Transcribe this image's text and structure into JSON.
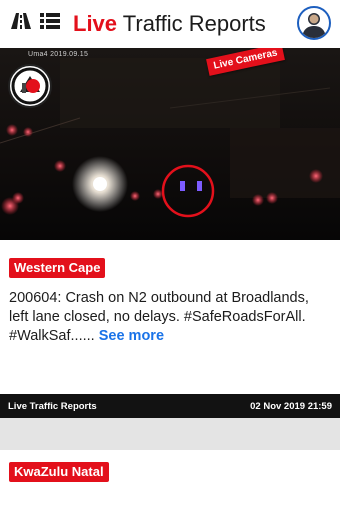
{
  "header": {
    "title_live": "Live",
    "title_rest": " Traffic Reports",
    "icons": [
      "road-icon",
      "list-icon",
      "user-avatar-icon"
    ]
  },
  "reports": [
    {
      "camera_stamp": "Uma4 2019.09.15",
      "camera_badge": "Live Cameras",
      "region": "Western Cape",
      "text": "200604: Crash on N2 outbound at Broadlands, left lane closed, no delays. #SafeRoadsForAll. #WalkSaf...... ",
      "see_more": "See more",
      "source": "Live Traffic Reports",
      "timestamp": "02 Nov 2019 21:59"
    },
    {
      "region": "KwaZulu Natal"
    }
  ],
  "colors": {
    "accent_red": "#e3101b",
    "link_blue": "#1a73e8",
    "footer_bg": "#121212",
    "page_bg": "#e4e4e4"
  }
}
